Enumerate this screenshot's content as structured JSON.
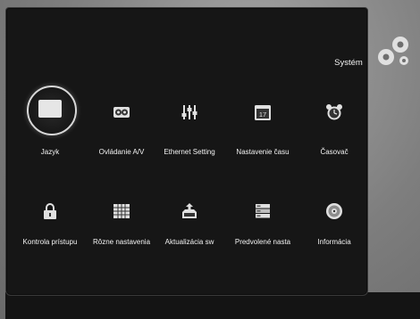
{
  "header": {
    "title": "Systém",
    "icon": "gears-icon"
  },
  "menu": {
    "selected": "Jazyk",
    "items": [
      {
        "label": "Jazyk",
        "icon": "language-icon"
      },
      {
        "label": "Ovládanie A/V",
        "icon": "av-control-icon"
      },
      {
        "label": "Ethernet Setting",
        "icon": "ethernet-settings-icon"
      },
      {
        "label": "Nastavenie času",
        "icon": "calendar-icon"
      },
      {
        "label": "Časovač",
        "icon": "alarm-clock-icon"
      },
      {
        "label": "Kontrola prístupu",
        "icon": "lock-icon"
      },
      {
        "label": "Rôzne nastavenia",
        "icon": "grid-settings-icon"
      },
      {
        "label": "Aktualizácia sw",
        "icon": "software-update-icon"
      },
      {
        "label": "Predvolené nasta",
        "icon": "default-settings-icon"
      },
      {
        "label": "Informácia",
        "icon": "info-disc-icon"
      }
    ],
    "calendar_day": "17"
  }
}
